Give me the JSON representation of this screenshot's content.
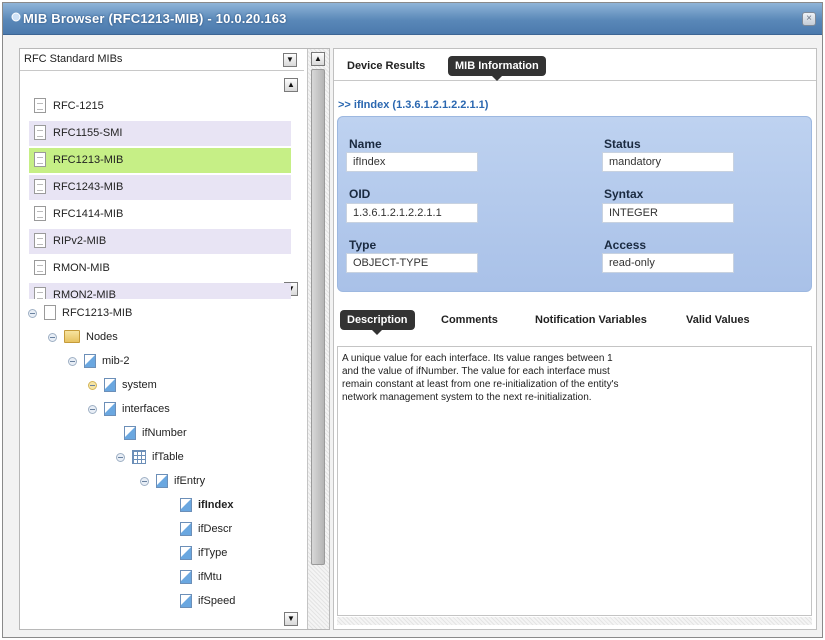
{
  "window": {
    "title": "MIB Browser (RFC1213-MIB) - 10.0.20.163",
    "close_glyph": "×"
  },
  "left": {
    "dropdown": {
      "value": "RFC Standard MIBs"
    },
    "list": [
      {
        "label": "RFC-1215",
        "bg": "#ffffff"
      },
      {
        "label": "RFC1155-SMI",
        "bg": "#e8e4f4"
      },
      {
        "label": "RFC1213-MIB",
        "bg": "#c6ef86",
        "selected": true
      },
      {
        "label": "RFC1243-MIB",
        "bg": "#e8e4f4"
      },
      {
        "label": "RFC1414-MIB",
        "bg": "#ffffff"
      },
      {
        "label": "RIPv2-MIB",
        "bg": "#e8e4f4"
      },
      {
        "label": "RMON-MIB",
        "bg": "#ffffff"
      },
      {
        "label": "RMON2-MIB",
        "bg": "#e8e4f4"
      }
    ],
    "tree": [
      {
        "label": "RFC1213-MIB",
        "icon": "document-icon"
      },
      {
        "label": "Nodes",
        "icon": "folder-icon"
      },
      {
        "label": "mib-2",
        "icon": "node-icon"
      },
      {
        "label": "system",
        "icon": "node-icon"
      },
      {
        "label": "interfaces",
        "icon": "node-icon"
      },
      {
        "label": "ifNumber",
        "icon": "node-icon"
      },
      {
        "label": "ifTable",
        "icon": "table-icon"
      },
      {
        "label": "ifEntry",
        "icon": "node-icon"
      },
      {
        "label": "ifIndex",
        "icon": "node-icon",
        "bold": true
      },
      {
        "label": "ifDescr",
        "icon": "node-icon"
      },
      {
        "label": "ifType",
        "icon": "node-icon"
      },
      {
        "label": "ifMtu",
        "icon": "node-icon"
      },
      {
        "label": "ifSpeed",
        "icon": "node-icon"
      }
    ]
  },
  "right": {
    "tabs": [
      {
        "label": "Device Results",
        "active": false
      },
      {
        "label": "MIB Information",
        "active": true
      }
    ],
    "breadcrumb": ">> ifIndex (1.3.6.1.2.1.2.2.1.1)",
    "fields": {
      "name": {
        "label": "Name",
        "value": "ifIndex"
      },
      "status": {
        "label": "Status",
        "value": "mandatory"
      },
      "oid": {
        "label": "OID",
        "value": "1.3.6.1.2.1.2.2.1.1"
      },
      "syntax": {
        "label": "Syntax",
        "value": "INTEGER"
      },
      "type": {
        "label": "Type",
        "value": "OBJECT-TYPE"
      },
      "access": {
        "label": "Access",
        "value": "read-only"
      }
    },
    "desc_tabs": [
      {
        "label": "Description",
        "active": true
      },
      {
        "label": "Comments",
        "active": false
      },
      {
        "label": "Notification Variables",
        "active": false
      },
      {
        "label": "Valid Values",
        "active": false
      }
    ],
    "description": "A unique value for each interface.  Its value ranges between 1 and the value of ifNumber.  The value for each interface must remain constant at least from one re-initialization of the entity's network management system to the next re-initialization."
  }
}
